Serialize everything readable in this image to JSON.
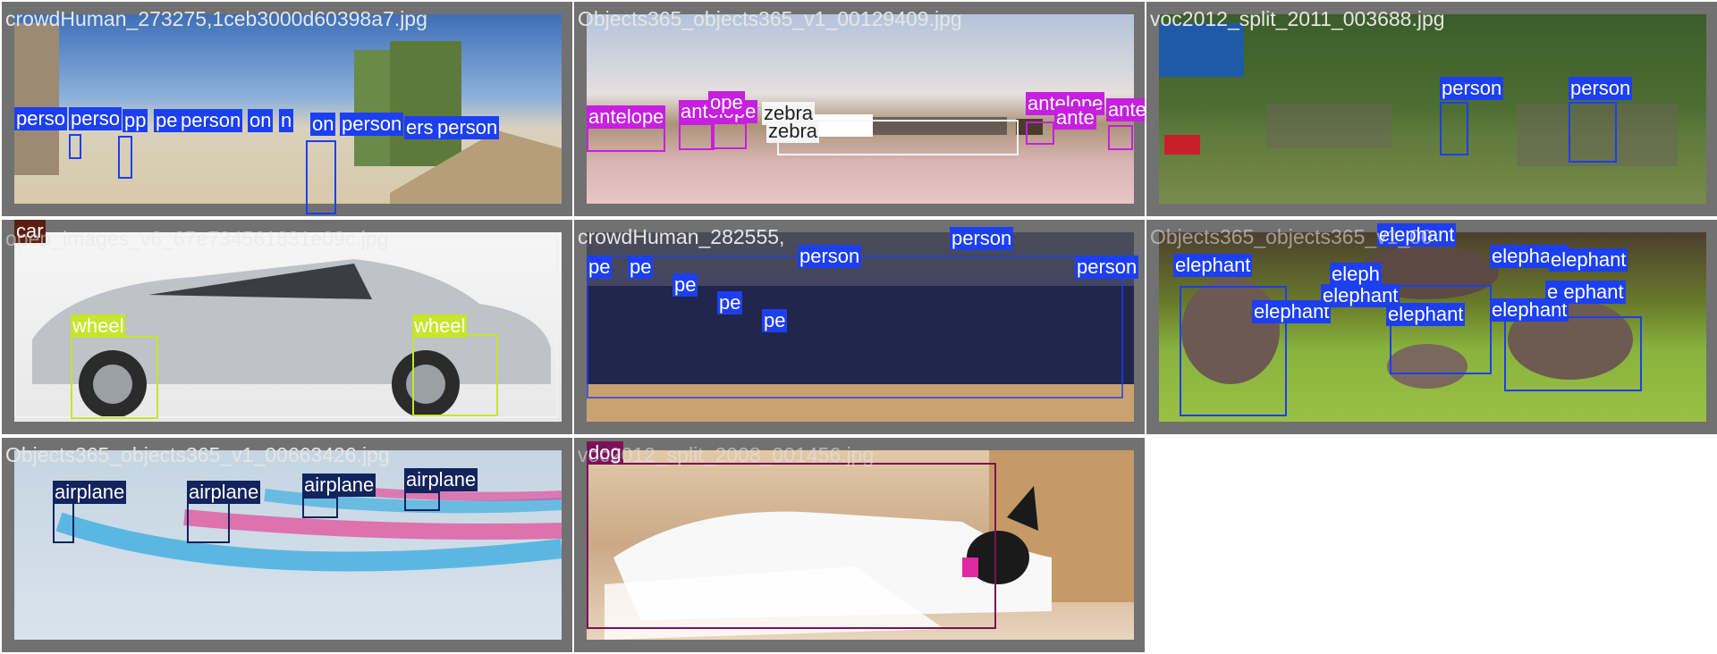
{
  "grid": {
    "tiles": [
      {
        "title": "crowdHuman_273275,1ceb3000d60398a7.jpg",
        "labels": [
          "perso",
          "perso",
          "pp",
          "pe",
          "person",
          "on",
          "n",
          "on",
          "person",
          "ers",
          "person"
        ]
      },
      {
        "title": "Objects365_objects365_v1_00129409.jpg",
        "labels": [
          "antelope",
          "antelope",
          "ope",
          "zebra",
          "zebra",
          "antelope",
          "ante",
          "antelope"
        ]
      },
      {
        "title": "voc2012_split_2011_003688.jpg",
        "labels": [
          "person",
          "person"
        ]
      },
      {
        "title": "open_images_v6_67e734561831e09c.jpg",
        "labels": [
          "car",
          "wheel",
          "wheel"
        ]
      },
      {
        "title": "crowdHuman_282555,",
        "labels": [
          "person",
          "person",
          "person",
          "pe",
          "pe",
          "pe",
          "pe",
          "pe"
        ]
      },
      {
        "title": "Objects365_objects365_v1_00",
        "labels": [
          "elephant",
          "elephant",
          "elephant",
          "elephant",
          "eleph",
          "elephant",
          "elephant",
          "elephant",
          "elephant",
          "e ephant"
        ]
      },
      {
        "title": "Objects365_objects365_v1_00663426.jpg",
        "labels": [
          "airplane",
          "airplane",
          "airplane",
          "airplane"
        ]
      },
      {
        "title": "voc2012_split_2008_001456.jpg",
        "labels": [
          "dog"
        ]
      }
    ]
  },
  "colors": {
    "tile_bg": "#717171",
    "person": "#1c3ff2",
    "antelope": "#c61fe0",
    "zebra": "#f5f5f5",
    "wheel": "#c7e52a",
    "airplane": "#12235d",
    "dog": "#7a1258",
    "car": "#5c1e12"
  }
}
